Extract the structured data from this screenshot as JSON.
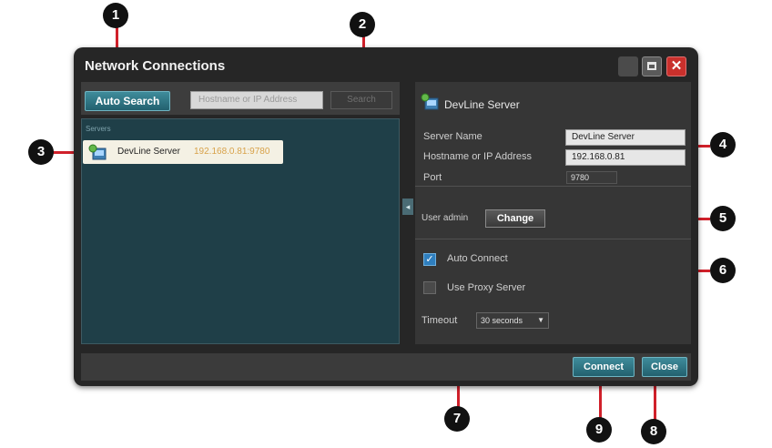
{
  "window": {
    "title": "Network Connections"
  },
  "toolbar": {
    "auto_search_label": "Auto Search",
    "host_placeholder": "Hostname or IP Address",
    "search_label": "Search"
  },
  "list": {
    "heading": "Servers",
    "items": [
      {
        "name": "DevLine Server",
        "address": "192.168.0.81:9780"
      }
    ]
  },
  "details": {
    "server_title": "DevLine Server",
    "server_name_label": "Server Name",
    "server_name_value": "DevLine Server",
    "host_label": "Hostname or IP Address",
    "host_value": "192.168.0.81",
    "port_label": "Port",
    "port_value": "9780",
    "user_text": "User admin",
    "change_label": "Change",
    "auto_connect_label": "Auto Connect",
    "auto_connect_checked": true,
    "proxy_label": "Use Proxy Server",
    "proxy_checked": false,
    "timeout_label": "Timeout",
    "timeout_value": "30 seconds"
  },
  "footer": {
    "connect_label": "Connect",
    "close_label": "Close"
  },
  "markers": [
    "1",
    "2",
    "3",
    "4",
    "5",
    "6",
    "7",
    "8",
    "9"
  ],
  "colors": {
    "accent": "#2e7a8a",
    "marker_line": "#d0202a",
    "close_button": "#c9302c"
  }
}
